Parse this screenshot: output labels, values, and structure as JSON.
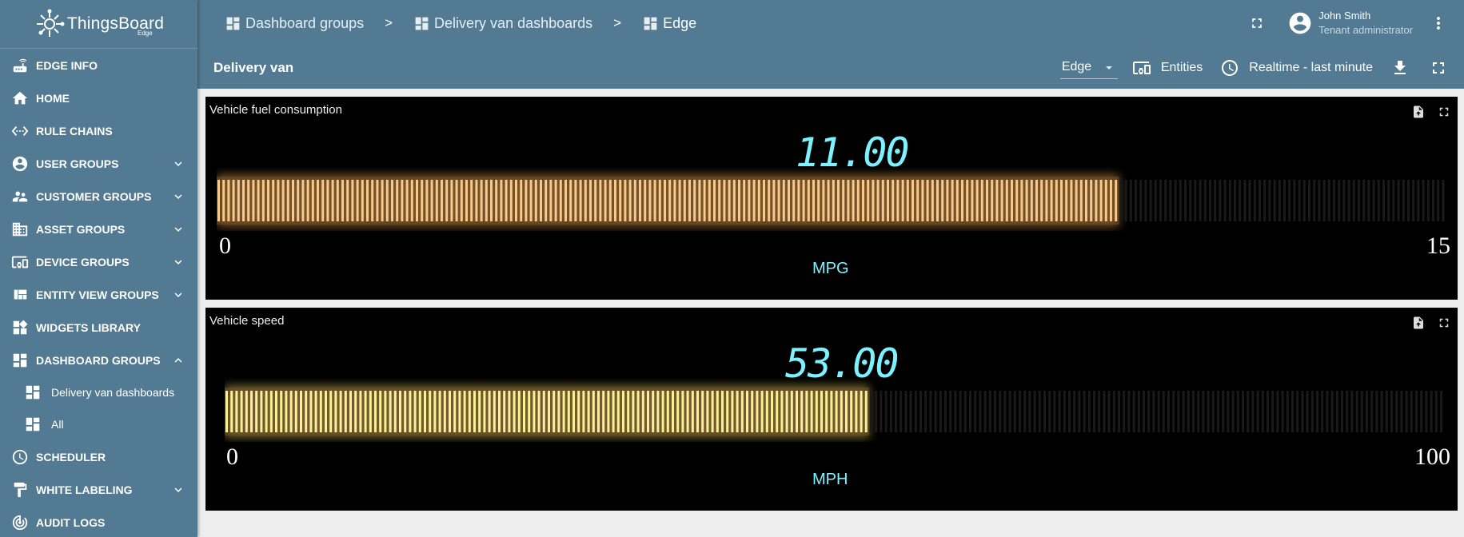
{
  "app": {
    "logo_text": "ThingsBoard",
    "logo_sub": "Edge"
  },
  "sidebar": {
    "items": [
      {
        "label": "EDGE INFO",
        "icon": "router-icon",
        "expandable": false
      },
      {
        "label": "HOME",
        "icon": "home-icon",
        "expandable": false
      },
      {
        "label": "RULE CHAINS",
        "icon": "settings-ethernet-icon",
        "expandable": false
      },
      {
        "label": "USER GROUPS",
        "icon": "account-circle-icon",
        "expandable": true
      },
      {
        "label": "CUSTOMER GROUPS",
        "icon": "supervisor-account-icon",
        "expandable": true
      },
      {
        "label": "ASSET GROUPS",
        "icon": "domain-icon",
        "expandable": true
      },
      {
        "label": "DEVICE GROUPS",
        "icon": "devices-other-icon",
        "expandable": true
      },
      {
        "label": "ENTITY VIEW GROUPS",
        "icon": "view-quilt-icon",
        "expandable": true
      },
      {
        "label": "WIDGETS LIBRARY",
        "icon": "widgets-icon",
        "expandable": false
      },
      {
        "label": "DASHBOARD GROUPS",
        "icon": "dashboard-icon",
        "expandable": true,
        "expanded": true
      },
      {
        "label": "Delivery van dashboards",
        "icon": "dashboard-icon",
        "sub": true
      },
      {
        "label": "All",
        "icon": "dashboard-icon",
        "sub": true
      },
      {
        "label": "SCHEDULER",
        "icon": "schedule-icon",
        "expandable": false
      },
      {
        "label": "WHITE LABELING",
        "icon": "format-paint-icon",
        "expandable": true
      },
      {
        "label": "AUDIT LOGS",
        "icon": "track-changes-icon",
        "expandable": false
      }
    ]
  },
  "breadcrumb": {
    "items": [
      "Dashboard groups",
      "Delivery van dashboards",
      "Edge"
    ],
    "separator": ">"
  },
  "user": {
    "name": "John Smith",
    "role": "Tenant administrator"
  },
  "toolbar": {
    "dashboard_title": "Delivery van",
    "state_select": "Edge",
    "entities_label": "Entities",
    "timewindow_label": "Realtime - last minute"
  },
  "widgets": [
    {
      "title": "Vehicle fuel consumption",
      "value_text": "11.00",
      "value": 11,
      "unit": "MPG",
      "min_label": "0",
      "max_label": "15",
      "min": 0,
      "max": 15,
      "bar_color": "#f7c98c",
      "glow_color": "#f0a850"
    },
    {
      "title": "Vehicle speed",
      "value_text": "53.00",
      "value": 53,
      "unit": "MPH",
      "min_label": "0",
      "max_label": "100",
      "min": 0,
      "max": 100,
      "bar_color": "#f8f09a",
      "glow_color": "#e8d060"
    }
  ],
  "colors": {
    "primary": "#527a92",
    "background": "#eeeeee",
    "lcd_text": "#7df2ff",
    "unlit_segment": "#1a1a1a"
  }
}
